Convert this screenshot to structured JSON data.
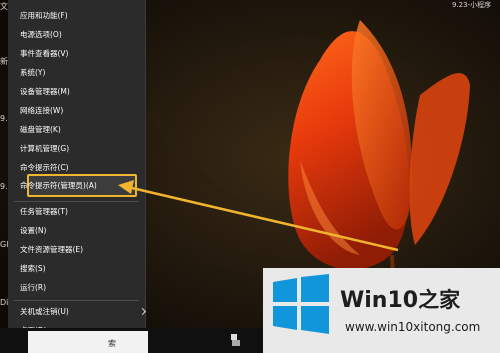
{
  "desktop": {
    "top_left_text": "文",
    "left_labels": [
      "新",
      "9.2",
      "9.2",
      "Gl",
      "Di"
    ],
    "top_right_text": "9.23-小程序"
  },
  "menu": {
    "items": [
      {
        "label": "应用和功能(F)"
      },
      {
        "label": "电源选项(O)"
      },
      {
        "label": "事件查看器(V)"
      },
      {
        "label": "系统(Y)"
      },
      {
        "label": "设备管理器(M)"
      },
      {
        "label": "网络连接(W)"
      },
      {
        "label": "磁盘管理(K)"
      },
      {
        "label": "计算机管理(G)"
      },
      {
        "label": "命令提示符(C)"
      },
      {
        "label": "命令提示符(管理员)(A)",
        "highlighted": true
      },
      {
        "label": "任务管理器(T)"
      },
      {
        "label": "设置(N)"
      },
      {
        "label": "文件资源管理器(E)"
      },
      {
        "label": "搜索(S)"
      },
      {
        "label": "运行(R)"
      },
      {
        "label": "关机或注销(U)",
        "has_submenu": true
      },
      {
        "label": "桌面(D)"
      }
    ],
    "highlight_color": "#f1b42f"
  },
  "taskbar": {
    "search_label": "索"
  },
  "watermark": {
    "title_latin": "Win10",
    "title_zh": "之家",
    "url": "www.win10xitong.com",
    "flag_color": "#1296db"
  }
}
